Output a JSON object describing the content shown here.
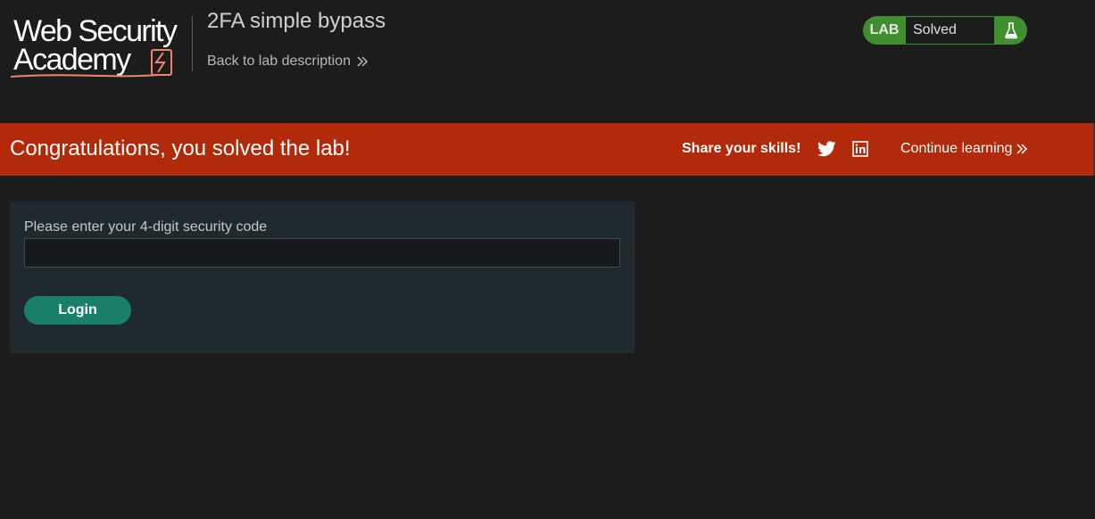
{
  "header": {
    "logo": {
      "line1": "Web Security",
      "line2": "Academy"
    },
    "lab_title": "2FA simple bypass",
    "back_link": "Back to lab description",
    "status": {
      "badge": "LAB",
      "value": "Solved",
      "icon": "flask-icon"
    }
  },
  "banner": {
    "message": "Congratulations, you solved the lab!",
    "share_label": "Share your skills!",
    "share_icons": [
      "twitter-icon",
      "linkedin-icon"
    ],
    "continue_label": "Continue learning"
  },
  "form": {
    "label": "Please enter your 4-digit security code",
    "value": "",
    "button_label": "Login"
  },
  "colors": {
    "background": "#1c1c1c",
    "banner": "#b32a0a",
    "status_green": "#3f8f2f",
    "button_teal": "#1a7f68",
    "card": "#1e2a2e",
    "logo_accent": "#f2836b"
  }
}
